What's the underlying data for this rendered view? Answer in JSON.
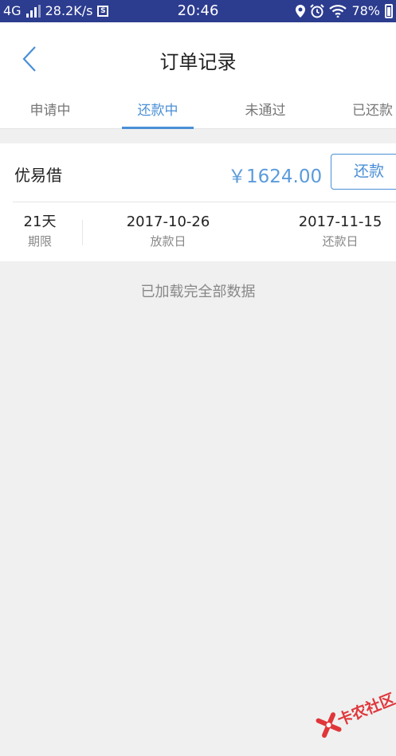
{
  "status_bar": {
    "network": "4G",
    "speed": "28.2K/s",
    "s_badge": "S",
    "time": "20:46",
    "battery": "78%",
    "icons": [
      "signal-icon",
      "location-icon",
      "alarm-icon",
      "wifi-icon",
      "battery-icon"
    ]
  },
  "header": {
    "title": "订单记录",
    "back_icon": "back-arrow-icon"
  },
  "tabs": [
    {
      "label": "申请中",
      "active": false
    },
    {
      "label": "还款中",
      "active": true
    },
    {
      "label": "未通过",
      "active": false
    },
    {
      "label": "已还款",
      "active": false
    }
  ],
  "order": {
    "product": "优易借",
    "amount": "￥1624.00",
    "repay_label": "还款",
    "term_value": "21天",
    "term_label": "期限",
    "loan_date": "2017-10-26",
    "loan_date_label": "放款日",
    "due_date": "2017-11-15",
    "due_date_label": "还款日"
  },
  "footer_message": "已加载完全部数据",
  "watermark": {
    "text": "卡农社区"
  },
  "colors": {
    "status_bar": "#2c3c8f",
    "accent": "#4a8fd6",
    "amount": "#5a9bdc",
    "watermark": "#e0363a"
  }
}
